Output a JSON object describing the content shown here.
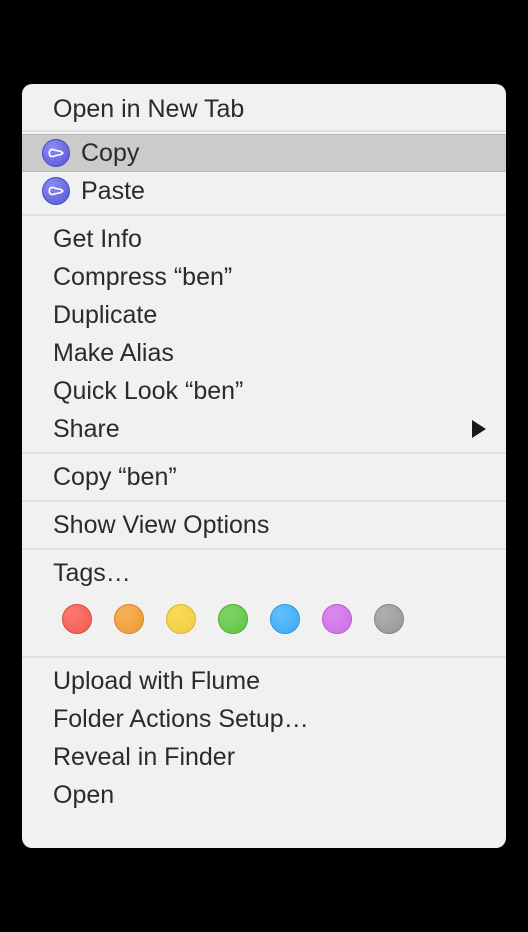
{
  "menu": {
    "open_in_new_tab": "Open in New Tab",
    "copy": "Copy",
    "paste": "Paste",
    "get_info": "Get Info",
    "compress": "Compress “ben”",
    "duplicate": "Duplicate",
    "make_alias": "Make Alias",
    "quick_look": "Quick Look “ben”",
    "share": "Share",
    "copy_item": "Copy “ben”",
    "show_view_options": "Show View Options",
    "tags": "Tags…",
    "upload_with_flume": "Upload with Flume",
    "folder_actions_setup": "Folder Actions Setup…",
    "reveal_in_finder": "Reveal in Finder",
    "open": "Open"
  },
  "tag_colors": [
    "red",
    "orange",
    "yellow",
    "green",
    "blue",
    "purple",
    "gray"
  ]
}
